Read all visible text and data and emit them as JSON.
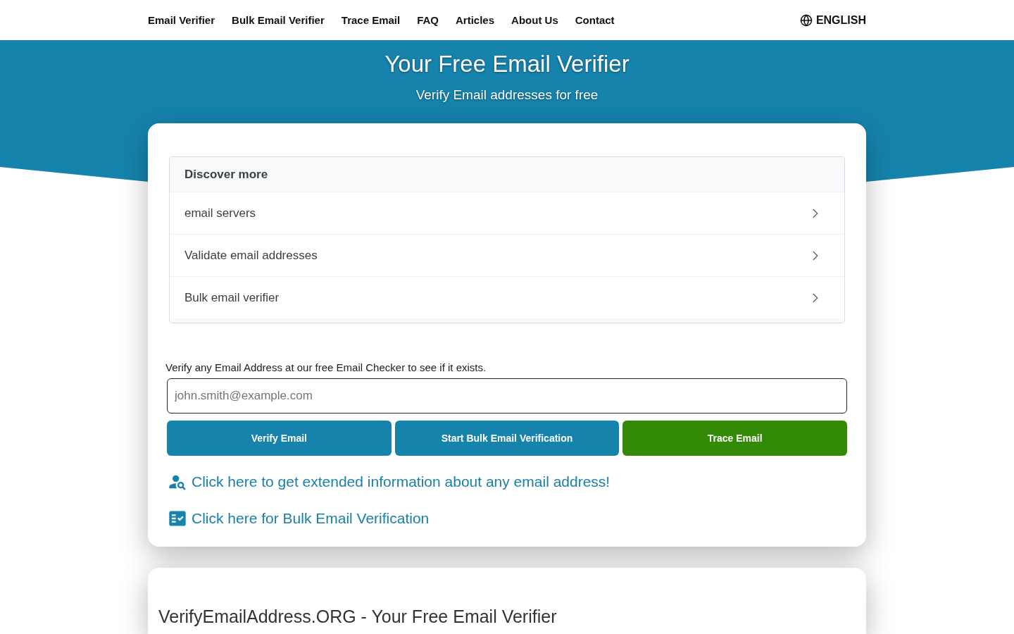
{
  "nav": {
    "links": [
      "Email Verifier",
      "Bulk Email Verifier",
      "Trace Email",
      "FAQ",
      "Articles",
      "About Us",
      "Contact"
    ],
    "language": "ENGLISH"
  },
  "hero": {
    "title": "Your Free Email Verifier",
    "subtitle": "Verify Email addresses for free"
  },
  "discover": {
    "title": "Discover more",
    "items": [
      "email servers",
      "Validate email addresses",
      "Bulk email verifier"
    ]
  },
  "verify_form": {
    "label": "Verify any Email Address at our free Email Checker to see if it exists.",
    "email_field": {
      "placeholder": "john.smith@example.com"
    },
    "buttons": [
      {
        "label": "Verify Email",
        "kind": "primary"
      },
      {
        "label": "Start Bulk Email Verification",
        "kind": "primary"
      },
      {
        "label": "Trace Email",
        "kind": "success"
      }
    ],
    "links": [
      {
        "label": "Click here to get extended information about any email address!",
        "kind": "person-search"
      },
      {
        "label": "Click here for Bulk Email Verification",
        "kind": "checklist"
      }
    ]
  },
  "about": {
    "title": "VerifyEmailAddress.ORG - Your Free Email Verifier"
  }
}
